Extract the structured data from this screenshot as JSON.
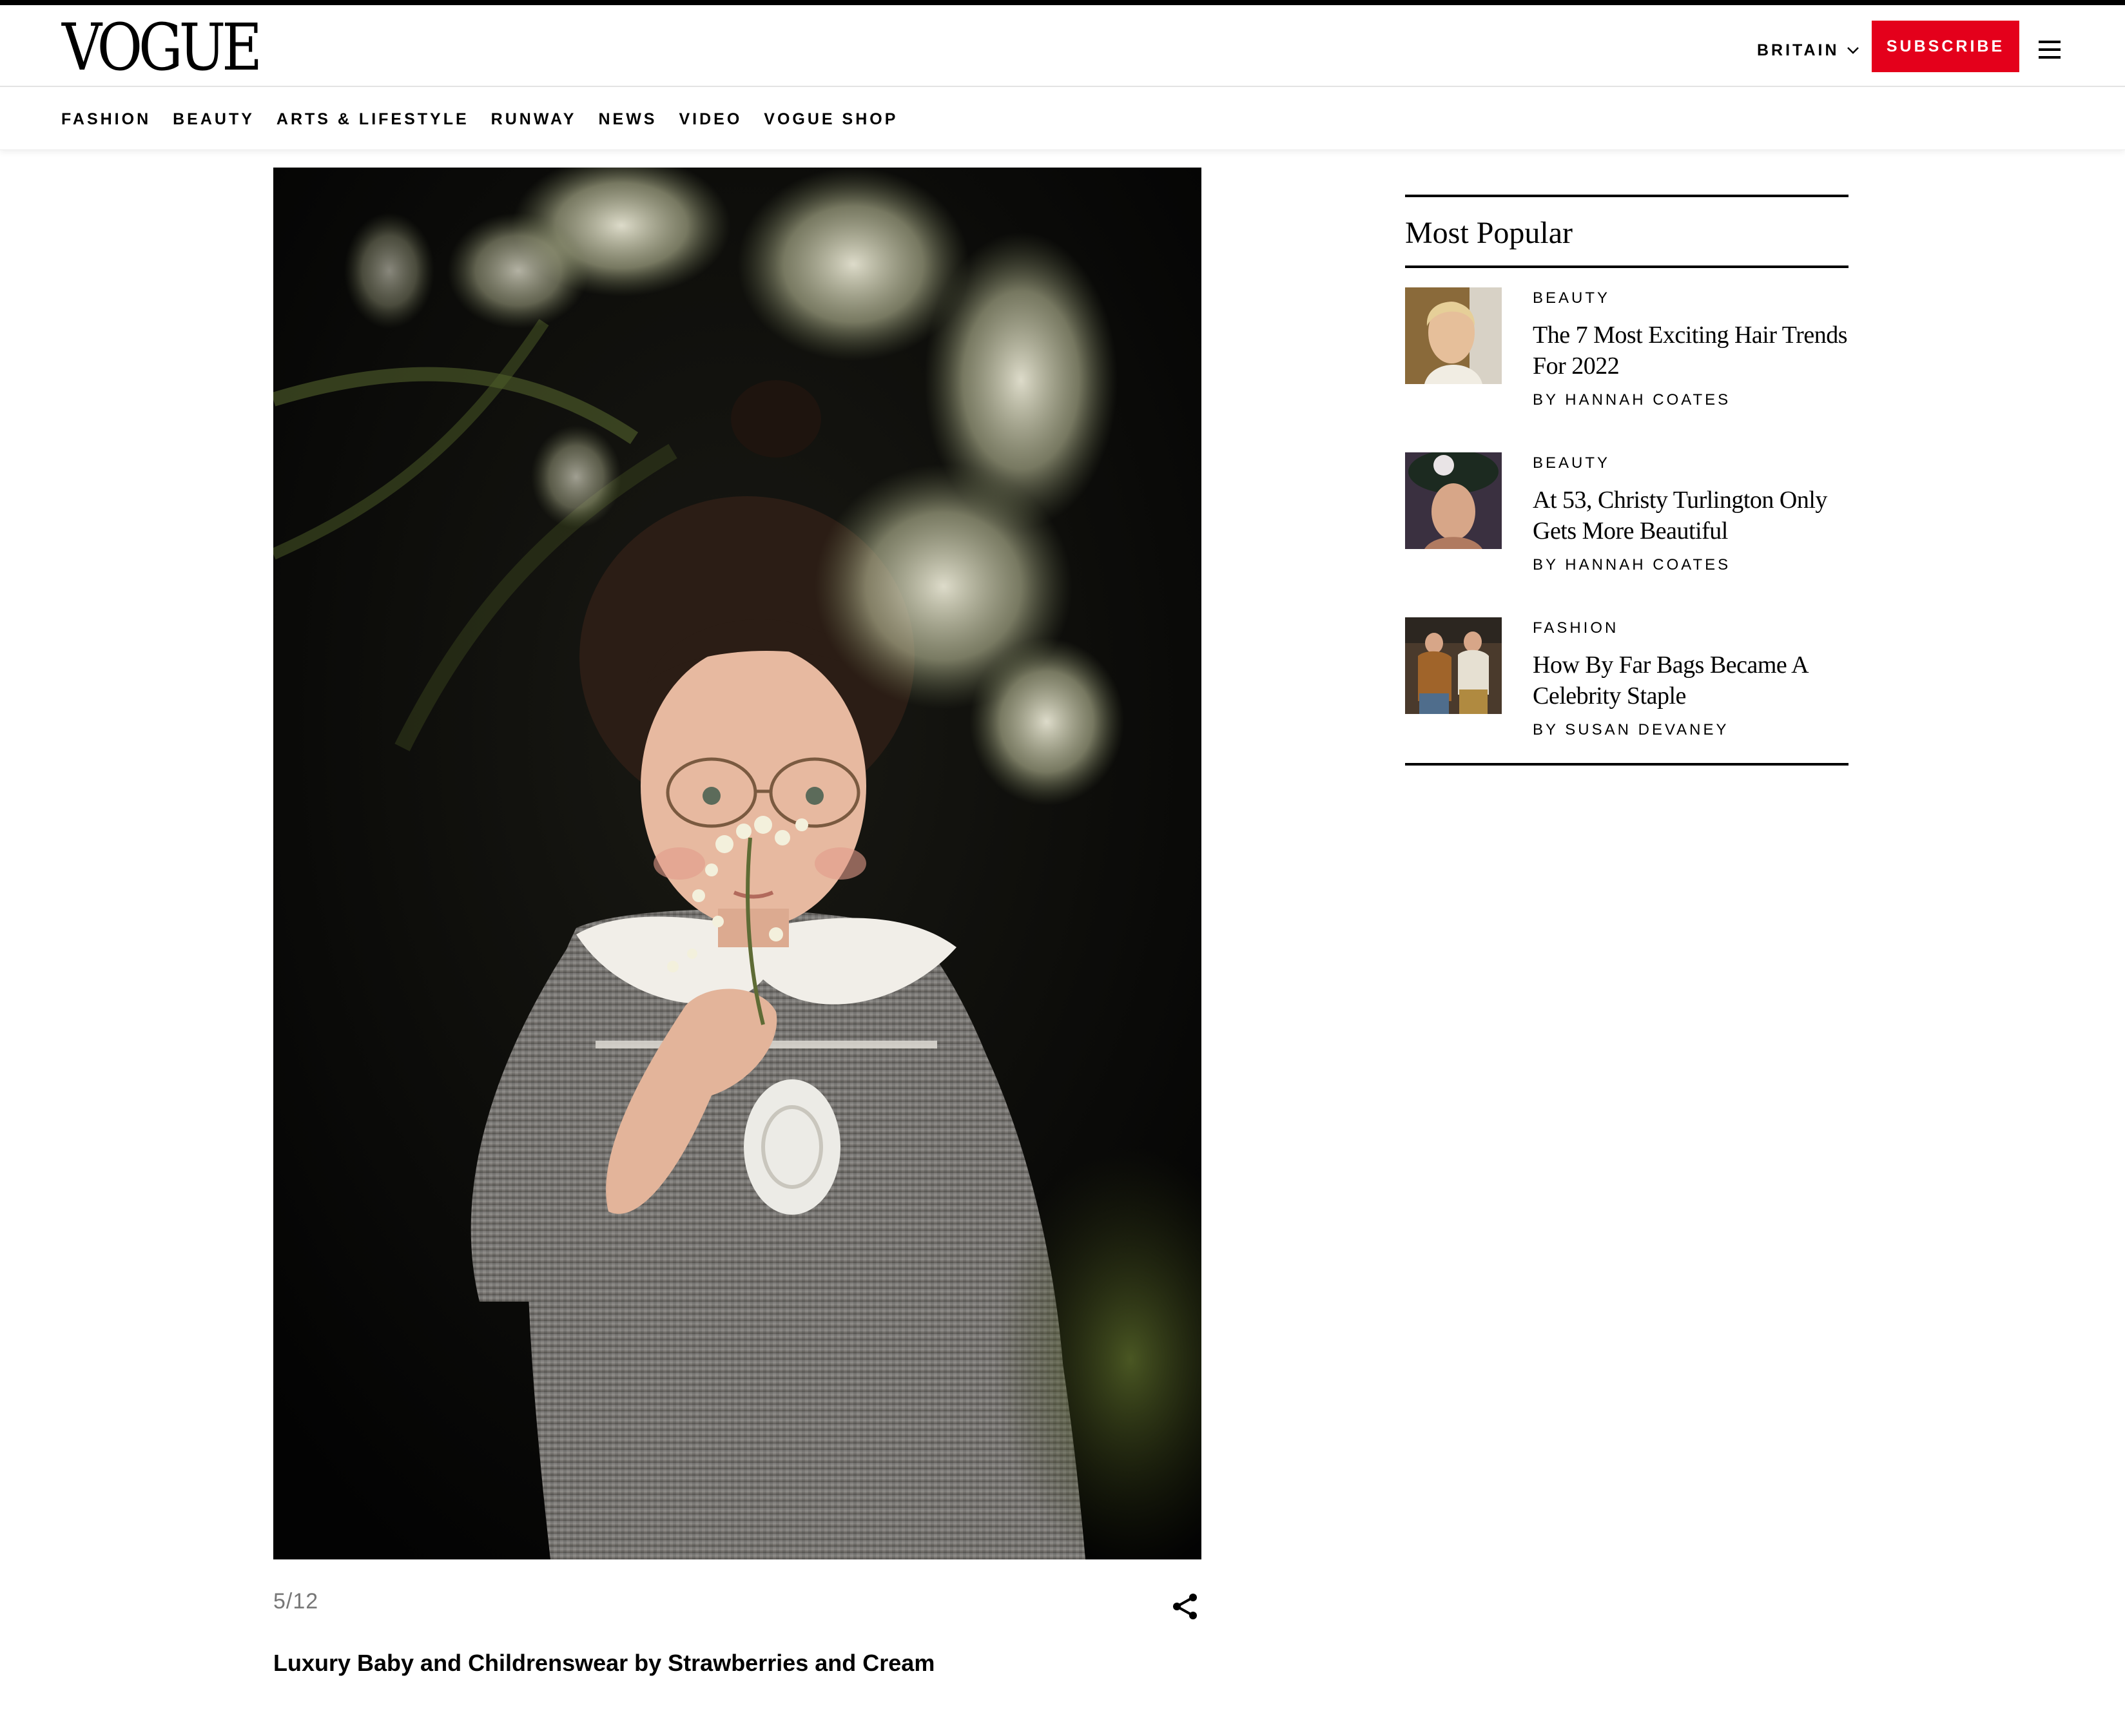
{
  "header": {
    "logo": "VOGUE",
    "region": "BRITAIN",
    "subscribe_label": "SUBSCRIBE",
    "menu_icon": "hamburger-menu-icon"
  },
  "nav": {
    "items": [
      "FASHION",
      "BEAUTY",
      "ARTS & LIFESTYLE",
      "RUNWAY",
      "NEWS",
      "VIDEO",
      "VOGUE SHOP"
    ]
  },
  "gallery": {
    "counter": "5/12",
    "caption": "Luxury Baby and Childrenswear by Strawberries and Cream",
    "share_icon": "share-icon"
  },
  "sidebar": {
    "title": "Most Popular",
    "items": [
      {
        "category": "BEAUTY",
        "headline": "The 7 Most Exciting Hair Trends For 2022",
        "byline": "BY HANNAH COATES"
      },
      {
        "category": "BEAUTY",
        "headline": "At 53, Christy Turlington Only Gets More Beautiful",
        "byline": "BY HANNAH COATES"
      },
      {
        "category": "FASHION",
        "headline": "How By Far Bags Became A Celebrity Staple",
        "byline": "BY SUSAN DEVANEY"
      }
    ]
  },
  "colors": {
    "brand_black": "#000000",
    "subscribe_red": "#e4001b"
  }
}
